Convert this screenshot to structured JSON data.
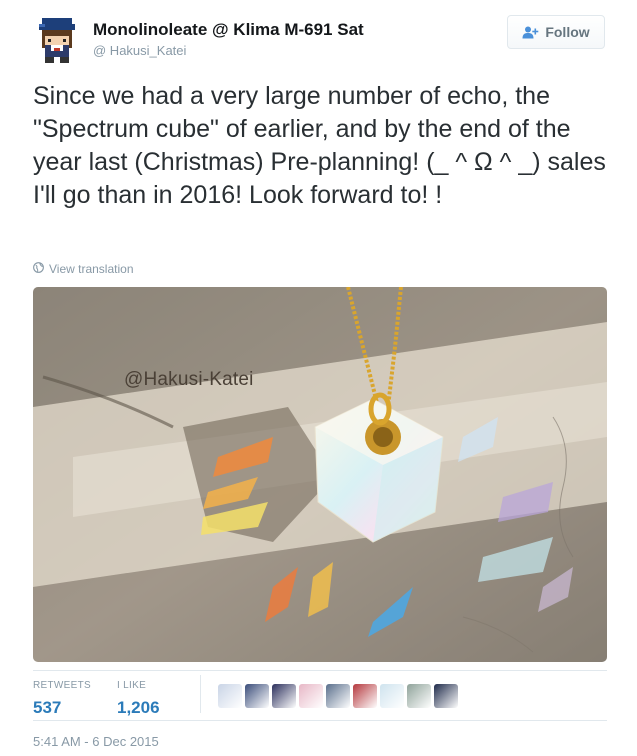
{
  "user": {
    "display_name": "Monolinoleate @ Klima M-691 Sat",
    "handle": "@ Hakusi_Katei"
  },
  "follow_button": {
    "label": "Follow"
  },
  "tweet": {
    "text": "Since we had a very large number of echo, the \"Spectrum cube\" of earlier, and by the end of the year last (Christmas) Pre-planning! (_ ^ Ω ^ _) sales I'll go than in 2016! Look forward to! !",
    "translation_link": "View translation"
  },
  "photo": {
    "watermark": "@Hakusi-Katei"
  },
  "stats": {
    "retweets_label": "RETWEETS",
    "retweets_count": "537",
    "likes_label": "I LIKE",
    "likes_count": "1,206"
  },
  "likers": {
    "colors": [
      "#c9d4e6",
      "#3a4d7a",
      "#2b2f5c",
      "#e7b7c6",
      "#5a6f8c",
      "#b5383e",
      "#cfe3ee",
      "#8fa39a",
      "#1e2a4a"
    ]
  },
  "timestamp": "5:41 AM - 6 Dec 2015",
  "icons": [
    "avatar-pixel-art",
    "add-user-icon",
    "globe-icon"
  ]
}
